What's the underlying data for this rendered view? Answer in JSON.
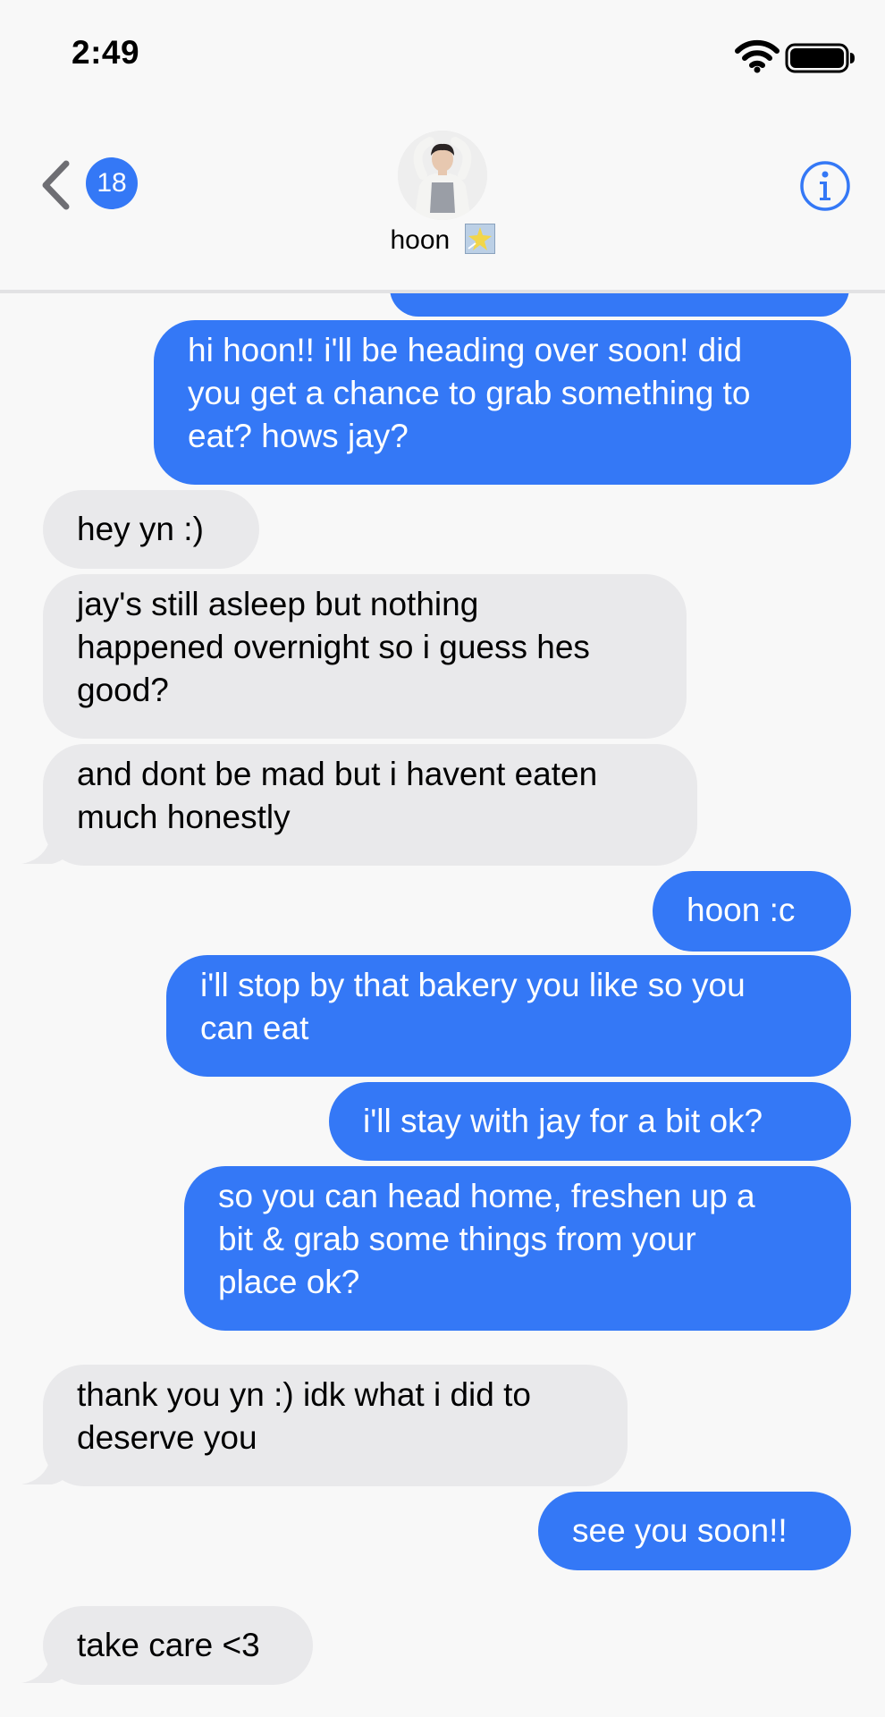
{
  "status_bar": {
    "time": "2:49"
  },
  "header": {
    "unread_count": "18",
    "contact_name": "hoon",
    "contact_emoji": "sparkle-star-emoji"
  },
  "colors": {
    "sent_bubble": "#3478f6",
    "received_bubble": "#e9e9eb",
    "background": "#f8f8f8"
  },
  "messages": [
    {
      "sender": "me",
      "lines": [
        "hi hoon!! i'll be heading over soon! did",
        "you get a chance to grab something to",
        "eat? hows jay?"
      ]
    },
    {
      "sender": "hoon",
      "lines": [
        "hey yn :)"
      ]
    },
    {
      "sender": "hoon",
      "lines": [
        "jay's still asleep but nothing",
        "happened overnight so i guess hes",
        "good?"
      ]
    },
    {
      "sender": "hoon",
      "lines": [
        "and dont be mad but i havent eaten",
        "much honestly"
      ]
    },
    {
      "sender": "me",
      "lines": [
        "hoon :c"
      ]
    },
    {
      "sender": "me",
      "lines": [
        "i'll stop by that bakery you like so you",
        "can eat"
      ]
    },
    {
      "sender": "me",
      "lines": [
        "i'll stay with jay for a bit ok?"
      ]
    },
    {
      "sender": "me",
      "lines": [
        "so you can head home, freshen up a",
        "bit & grab some things from your",
        "place ok?"
      ]
    },
    {
      "sender": "hoon",
      "lines": [
        "thank you yn :) idk what i did to",
        "deserve you"
      ]
    },
    {
      "sender": "me",
      "lines": [
        "see you soon!!"
      ]
    },
    {
      "sender": "hoon",
      "lines": [
        "take care <3"
      ]
    }
  ]
}
